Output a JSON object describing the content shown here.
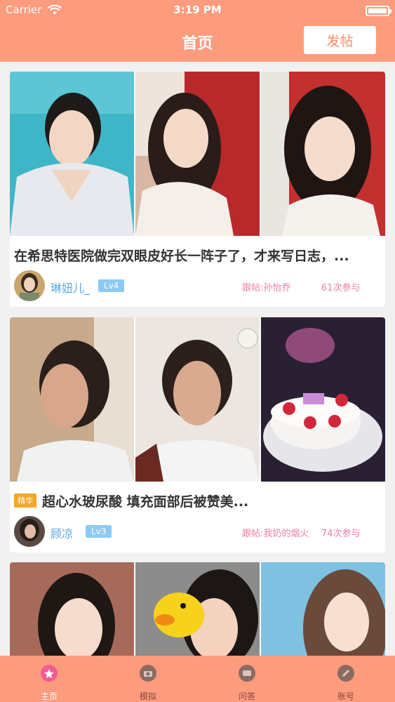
{
  "status_bar": {
    "carrier": "Carrier",
    "time": "3:19 PM"
  },
  "nav": {
    "title": "首页",
    "post_button": "发帖"
  },
  "posts": [
    {
      "title": "在希思特医院做完双眼皮好长一阵子了，才来写日志，...",
      "badge": "",
      "username": "琳妞儿_",
      "level": "Lv4",
      "follow": "跟帖:孙怡乔",
      "count": "61次参与"
    },
    {
      "title": "超心水玻尿酸 填充面部后被赞美...",
      "badge": "精华",
      "username": "顾凉",
      "level": "Lv3",
      "follow": "跟帖:我奶的烟火",
      "count": "74次参与"
    }
  ],
  "tabs": [
    {
      "label": "主页",
      "icon": "home-icon",
      "active": true
    },
    {
      "label": "模拟",
      "icon": "simulate-icon",
      "active": false
    },
    {
      "label": "问答",
      "icon": "qa-icon",
      "active": false
    },
    {
      "label": "账号",
      "icon": "account-icon",
      "active": false
    }
  ],
  "colors": {
    "brand": "#fd9b7d",
    "tab_active": "#ffffff",
    "tab_inactive": "#8a4a3a",
    "username": "#5aa7e6",
    "meta": "#f07da6",
    "badge": "#f6a623",
    "level": "#8ccaf4"
  }
}
